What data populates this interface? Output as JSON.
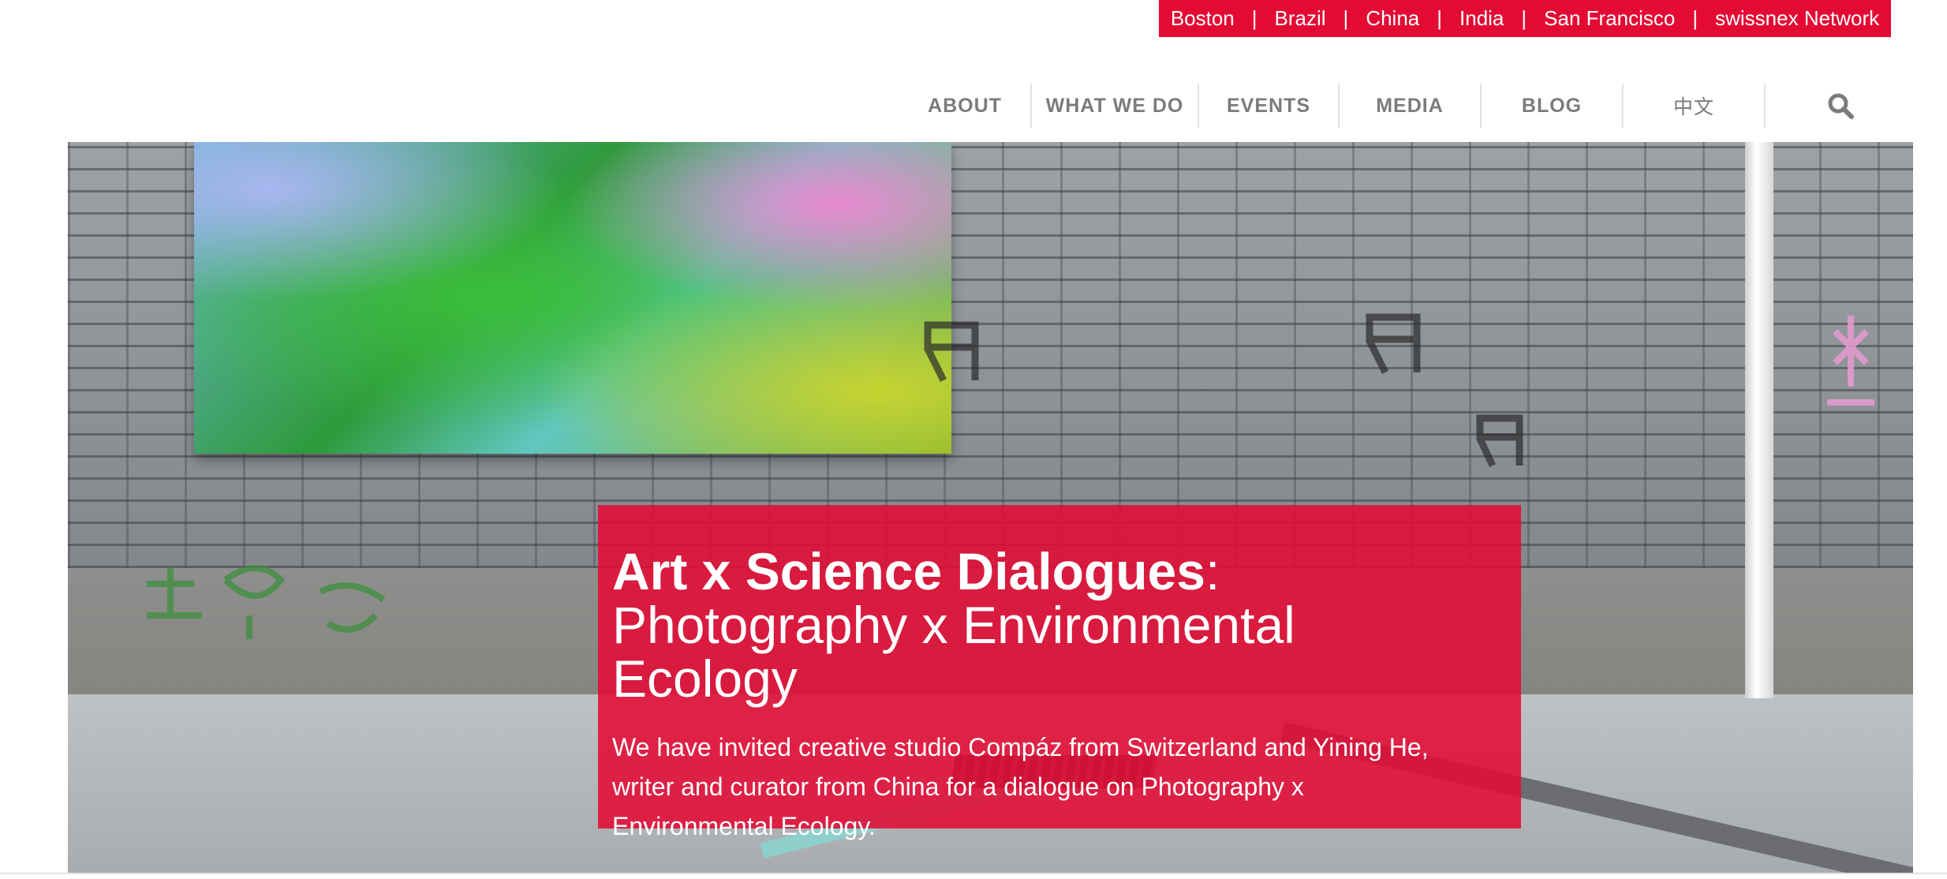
{
  "topbar": {
    "links": [
      "Boston",
      "Brazil",
      "China",
      "India",
      "San Francisco",
      "swissnex Network"
    ],
    "separator": "|",
    "background": "#e30b34"
  },
  "nav": {
    "items": [
      "ABOUT",
      "WHAT WE DO",
      "EVENTS",
      "MEDIA",
      "BLOG",
      "中文"
    ],
    "search_icon": "search-icon"
  },
  "hero": {
    "title_bold": "Art x Science Dialogues",
    "title_colon": ":",
    "title_rest_line1": "Photography x Environmental",
    "title_rest_line2": "Ecology",
    "description": "We have invited creative studio Compáz from Switzerland and Yining He, writer and curator from China for a dialogue on Photography x Environmental Ecology.",
    "overlay_color": "#e30b34"
  }
}
